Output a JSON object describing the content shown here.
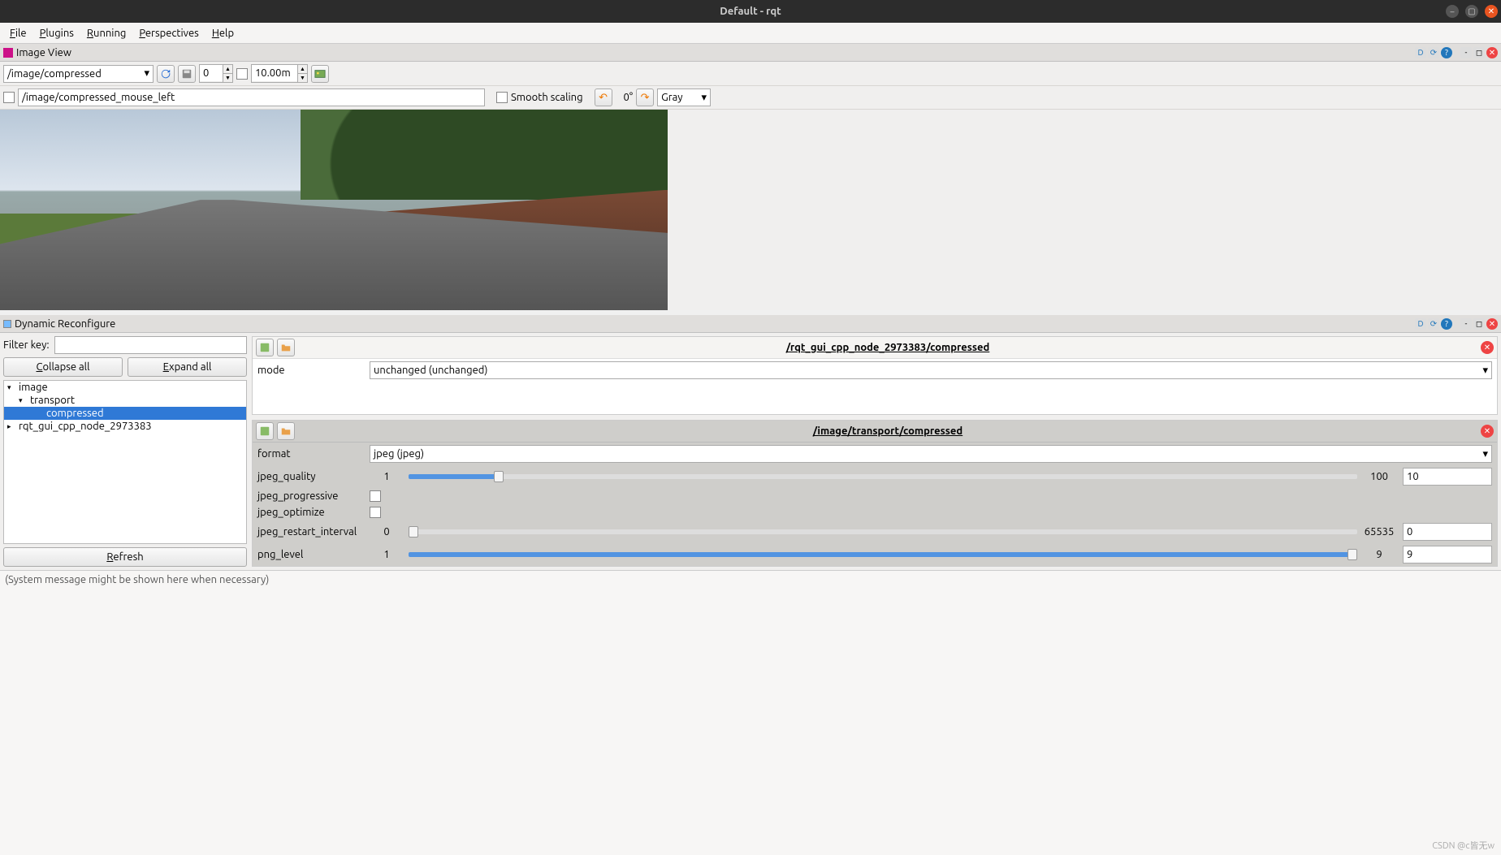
{
  "window": {
    "title": "Default - rqt"
  },
  "menubar": {
    "file": "File",
    "plugins": "Plugins",
    "running": "Running",
    "perspectives": "Perspectives",
    "help": "Help"
  },
  "image_view": {
    "title": "Image View",
    "topic": "/image/compressed",
    "num_value": "0",
    "zoom_value": "10.00m",
    "mouse_topic": "/image/compressed_mouse_left",
    "smooth_label": "Smooth scaling",
    "rotation": "0°",
    "color_mode": "Gray",
    "panel_badges": {
      "d": "D",
      "c": "⟳",
      "q": "?"
    }
  },
  "dyn": {
    "title": "Dynamic Reconfigure",
    "filter_label": "Filter key:",
    "collapse": "Collapse all",
    "expand": "Expand all",
    "refresh": "Refresh",
    "tree": {
      "n0": "image",
      "n1": "transport",
      "n2": "compressed",
      "n3": "rqt_gui_cpp_node_2973383"
    },
    "group1": {
      "title": "/rqt_gui_cpp_node_2973383/compressed",
      "mode_label": "mode",
      "mode_value": "unchanged (unchanged)"
    },
    "group2": {
      "title": "/image/transport/compressed",
      "format_label": "format",
      "format_value": "jpeg (jpeg)",
      "jpeg_quality_label": "jpeg_quality",
      "jpeg_quality_min": "1",
      "jpeg_quality_max": "100",
      "jpeg_quality_val": "10",
      "jpeg_progressive_label": "jpeg_progressive",
      "jpeg_optimize_label": "jpeg_optimize",
      "jpeg_restart_label": "jpeg_restart_interval",
      "jpeg_restart_min": "0",
      "jpeg_restart_max": "65535",
      "jpeg_restart_val": "0",
      "png_level_label": "png_level",
      "png_level_min": "1",
      "png_level_max": "9",
      "png_level_val": "9"
    }
  },
  "sysmsg": "(System message might be shown here when necessary)",
  "watermark": "CSDN @c皆无w"
}
